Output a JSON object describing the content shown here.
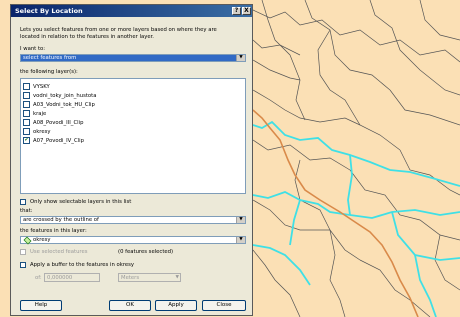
{
  "dialog": {
    "title": "Select By Location",
    "help_button": "?",
    "close_button": "X",
    "description_line1": "Lets you select features from one or more layers based on where they are",
    "description_line2": "located in relation to the features in another layer.",
    "want_label": "I want to:",
    "want_value": "select features from",
    "layers_label": "the following layer(s):",
    "layers": [
      {
        "name": "VYSKY",
        "checked": false
      },
      {
        "name": "vodni_toky_join_hustota",
        "checked": false
      },
      {
        "name": "A03_Vodni_tok_HU_Clip",
        "checked": false
      },
      {
        "name": "kraje",
        "checked": false
      },
      {
        "name": "A08_Povodi_III_Clip",
        "checked": false
      },
      {
        "name": "okresy",
        "checked": false
      },
      {
        "name": "A07_Povodi_IV_Clip",
        "checked": true
      }
    ],
    "only_selectable_label": "Only show selectable layers in this list",
    "that_label": "that:",
    "that_value": "are crossed by the outline of",
    "features_layer_label": "the features in this layer:",
    "features_layer_value": "okresy",
    "use_selected_label": "Use selected features",
    "features_selected_note": "(0 features selected)",
    "buffer_label": "Apply a buffer to the features in okresy",
    "of_label": "of:",
    "buffer_value": "0,000000",
    "buffer_unit": "Meters",
    "buttons": {
      "help": "Help",
      "ok": "OK",
      "apply": "Apply",
      "close": "Close"
    }
  },
  "map": {
    "background_color": "#fbe0b5",
    "boundary_color": "#555555",
    "river_color": "#3fe0e6",
    "road_color": "#d98a4a"
  }
}
